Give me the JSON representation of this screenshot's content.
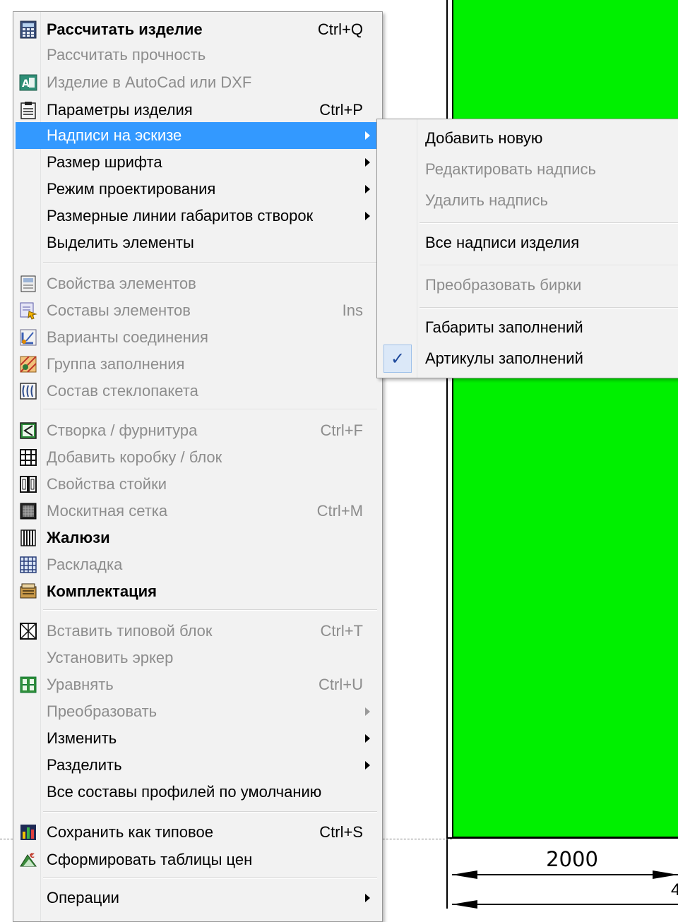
{
  "canvas": {
    "fill_color": "#00f000",
    "dimension_label": "2000",
    "dimension_label_partial": "4"
  },
  "main_menu": {
    "items": [
      {
        "label": "Рассчитать изделие",
        "shortcut": "Ctrl+Q",
        "icon": "calculator-icon",
        "bold": true
      },
      {
        "label": "Рассчитать прочность",
        "disabled": true
      },
      {
        "label": "Изделие в AutoCad или DXF",
        "icon": "autocad-icon",
        "disabled": true
      },
      {
        "label": "Параметры изделия",
        "shortcut": "Ctrl+P",
        "icon": "clipboard-icon"
      },
      {
        "label": "Надписи на эскизе",
        "submenu": true,
        "highlighted": true
      },
      {
        "label": "Размер шрифта",
        "submenu": true
      },
      {
        "label": "Режим проектирования",
        "submenu": true
      },
      {
        "label": "Размерные линии габаритов створок",
        "submenu": true
      },
      {
        "label": "Выделить элементы"
      },
      {
        "label": "Свойства элементов",
        "icon": "properties-icon",
        "disabled": true
      },
      {
        "label": "Составы элементов",
        "shortcut": "Ins",
        "icon": "composition-icon",
        "disabled": true
      },
      {
        "label": "Варианты соединения",
        "icon": "connection-icon",
        "disabled": true
      },
      {
        "label": "Группа  заполнения",
        "icon": "fill-group-icon",
        "disabled": true
      },
      {
        "label": "Состав стеклопакета",
        "icon": "glass-unit-icon",
        "disabled": true
      },
      {
        "label": "Створка  /  фурнитура",
        "shortcut": "Ctrl+F",
        "icon": "sash-icon",
        "disabled": true
      },
      {
        "label": "Добавить коробку / блок",
        "icon": "add-frame-icon",
        "disabled": true
      },
      {
        "label": "Свойства стойки",
        "icon": "mullion-icon",
        "disabled": true
      },
      {
        "label": "Москитная  сетка",
        "shortcut": "Ctrl+M",
        "icon": "mosquito-net-icon",
        "disabled": true
      },
      {
        "label": "Жалюзи",
        "icon": "blinds-icon",
        "bold": true
      },
      {
        "label": "Раскладка",
        "icon": "grid-layout-icon",
        "disabled": true
      },
      {
        "label": "Комплектация",
        "icon": "kit-icon",
        "bold": true
      },
      {
        "label": "Вставить типовой блок",
        "shortcut": "Ctrl+T",
        "icon": "insert-block-icon",
        "disabled": true
      },
      {
        "label": "Установить эркер",
        "disabled": true
      },
      {
        "label": "Уравнять",
        "shortcut": "Ctrl+U",
        "icon": "equalize-icon",
        "disabled": true
      },
      {
        "label": "Преобразовать",
        "submenu": true,
        "disabled": true
      },
      {
        "label": "Изменить",
        "submenu": true
      },
      {
        "label": "Разделить",
        "submenu": true
      },
      {
        "label": "Все составы профилей по умолчанию"
      },
      {
        "label": "Сохранить как типовое",
        "shortcut": "Ctrl+S",
        "icon": "save-chart-icon"
      },
      {
        "label": "Сформировать таблицы цен",
        "icon": "price-table-icon"
      },
      {
        "label": "Операции",
        "submenu": true
      }
    ]
  },
  "sub_menu": {
    "items": [
      {
        "label": "Добавить новую"
      },
      {
        "label": "Редактировать надпись",
        "disabled": true
      },
      {
        "label": "Удалить надпись",
        "disabled": true
      },
      {
        "label": "Все надписи изделия"
      },
      {
        "label": "Преобразовать бирки",
        "disabled": true
      },
      {
        "label": "Габариты заполнений"
      },
      {
        "label": "Артикулы заполнений",
        "checked": true,
        "check_mark": "✓"
      }
    ]
  }
}
